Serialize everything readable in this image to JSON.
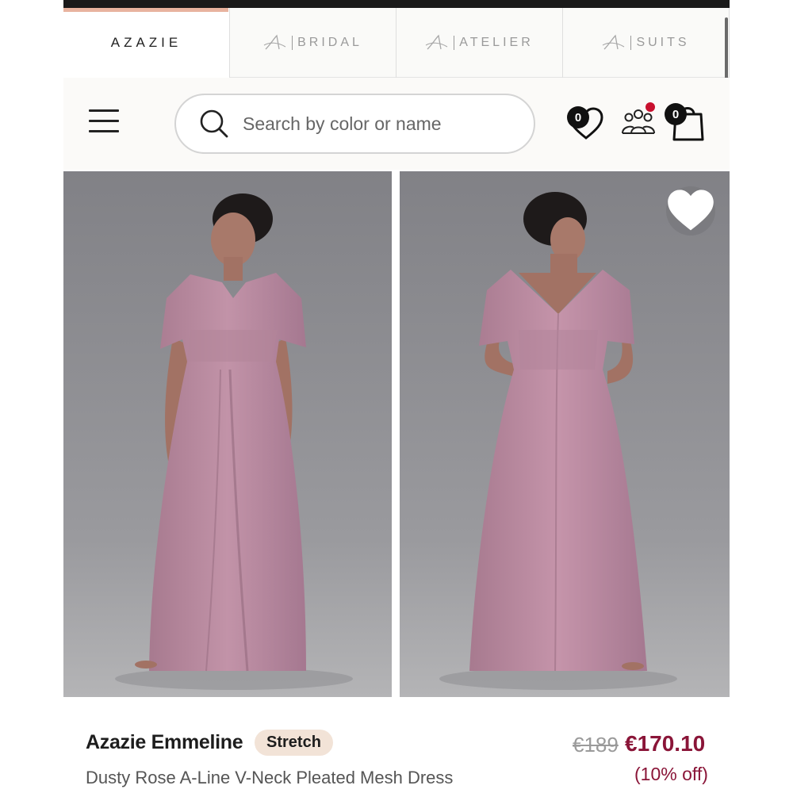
{
  "brand_tabs": [
    {
      "label": "AZAZIE",
      "active": true
    },
    {
      "label": "BRIDAL",
      "active": false
    },
    {
      "label": "ATELIER",
      "active": false
    },
    {
      "label": "SUITS",
      "active": false
    }
  ],
  "search": {
    "placeholder": "Search by color or name"
  },
  "header": {
    "wishlist_count": "0",
    "cart_count": "0"
  },
  "icons": {
    "menu": "hamburger-menu-icon",
    "search": "search-icon",
    "wishlist": "heart-icon",
    "community": "people-group-icon",
    "cart": "shopping-bag-icon",
    "favorite": "heart-icon"
  },
  "product": {
    "name": "Azazie Emmeline",
    "badge": "Stretch",
    "description": "Dusty Rose A-Line V-Neck Pleated Mesh Dress",
    "price_original": "€189",
    "price_sale": "€170.10",
    "discount": "(10% off)"
  },
  "colors": {
    "sale_price": "#8a1538",
    "badge_bg": "#f2e3d7",
    "active_tab_accent": "#e8b39f",
    "dress": "#b98a9f",
    "notification_dot": "#c8102e"
  }
}
